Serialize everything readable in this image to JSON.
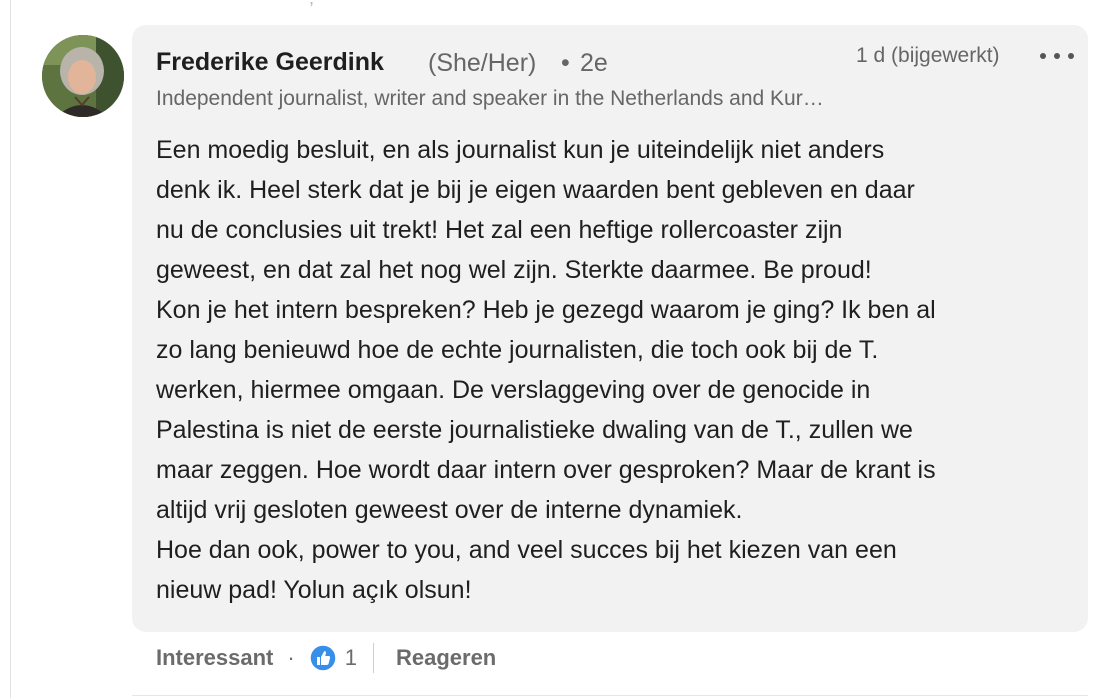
{
  "top_fragment": ",",
  "comment": {
    "author": {
      "name": "Frederike Geerdink",
      "pronouns": "(She/Her)",
      "separator": "•",
      "degree": "2e",
      "headline": "Independent journalist, writer and speaker in the Netherlands and Kur…",
      "avatar_icon": "profile-photo"
    },
    "timestamp": "1 d (bijgewerkt)",
    "more_icon": "ellipsis-icon",
    "body_paragraphs": [
      "Een moedig besluit, en als journalist kun je uiteindelijk niet anders\ndenk ik. Heel sterk dat je bij je eigen waarden bent gebleven en daar\nnu de conclusies uit trekt! Het zal een heftige rollercoaster zijn\ngeweest, en dat zal het nog wel zijn. Sterkte daarmee. Be proud!",
      "Kon je het intern bespreken? Heb je gezegd waarom je ging? Ik ben al\nzo lang benieuwd hoe de echte journalisten, die toch ook bij de T.\nwerken, hiermee omgaan. De verslaggeving over de genocide in\nPalestina is niet de eerste journalistieke dwaling van de T., zullen we\nmaar zeggen. Hoe wordt daar intern over gesproken? Maar de krant is\naltijd vrij gesloten geweest over de interne dynamiek.",
      "Hoe dan ook, power to you, and veel succes bij het kiezen van een\nnieuw pad! Yolun açık olsun!"
    ],
    "actions": {
      "react_label": "Interessant",
      "dot": "·",
      "reaction_icon": "like-thumbs-up-icon",
      "reaction_count": "1",
      "reply_label": "Reageren"
    }
  },
  "colors": {
    "bubble_bg": "#f2f2f2",
    "text_primary": "#1f1f1f",
    "text_secondary": "#666666",
    "like_blue": "#378fe9"
  }
}
